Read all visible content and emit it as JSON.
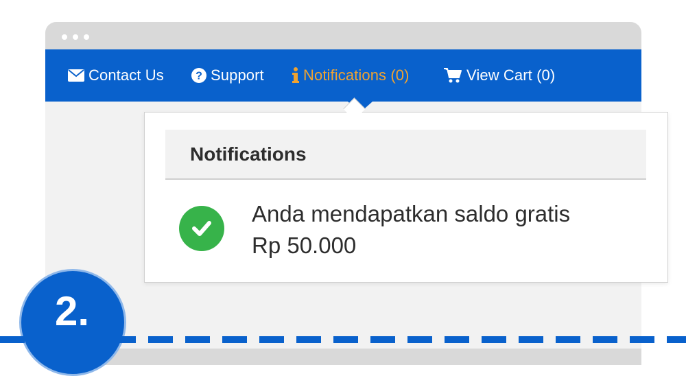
{
  "nav": {
    "contact_label": "Contact Us",
    "support_label": "Support",
    "notifications_label": "Notifications (0)",
    "cart_label": "View Cart (0)"
  },
  "icons": {
    "contact": "envelope-icon",
    "support": "question-circle-icon",
    "notifications": "info-icon",
    "cart": "shopping-cart-icon",
    "success": "check-circle-icon"
  },
  "dropdown": {
    "title": "Notifications",
    "notification_line1": "Anda mendapatkan saldo gratis",
    "notification_line2": "Rp 50.000"
  },
  "step": {
    "label": "2."
  },
  "colors": {
    "nav_background": "#0961cc",
    "active_nav": "#f0a330",
    "success_green": "#37b34a",
    "window_chrome": "#d9d9d9"
  }
}
